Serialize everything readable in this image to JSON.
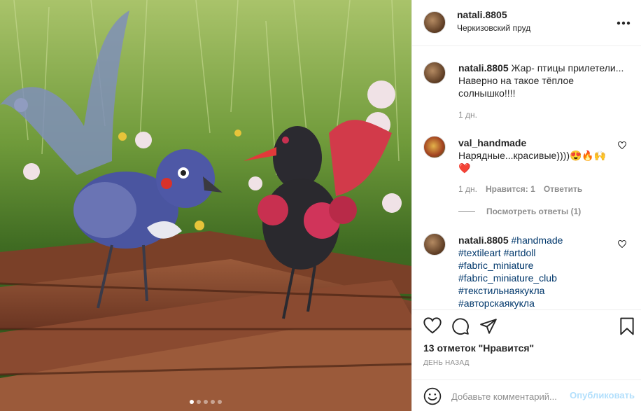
{
  "photo": {
    "description_icon": "image",
    "carousel_dots": 5,
    "active_dot": 1
  },
  "header": {
    "username": "natali.8805",
    "location": "Черкизовский пруд",
    "more_icon": "more-horizontal-icon"
  },
  "caption": {
    "username": "natali.8805",
    "text": "Жар- птицы прилетели... Наверно на такое тёплое солнышко!!!!",
    "time": "1 дн."
  },
  "comment1": {
    "username": "val_handmade",
    "text": "Нарядные...красивые))))😍🔥🙌",
    "text2": "❤️",
    "time": "1 дн.",
    "likes": "Нравится: 1",
    "reply": "Ответить",
    "view_replies": "Посмотреть ответы (1)"
  },
  "comment2": {
    "username": "natali.8805",
    "tags": [
      "#handmade",
      "#textileart",
      "#artdoll",
      "#fabric_miniature",
      "#fabric_miniature_club",
      "#текстильнаякукла",
      "#авторскаякукла"
    ]
  },
  "actions": {
    "likes_text": "13 отметок \"Нравится\"",
    "time_ago": "ДЕНЬ НАЗАД"
  },
  "add_comment": {
    "placeholder": "Добавьте комментарий...",
    "publish_label": "Опубликовать"
  },
  "colors": {
    "link": "#00376b",
    "muted": "#8e8e8e",
    "publish_disabled": "#b2dffc",
    "heart": "#ed4956"
  }
}
